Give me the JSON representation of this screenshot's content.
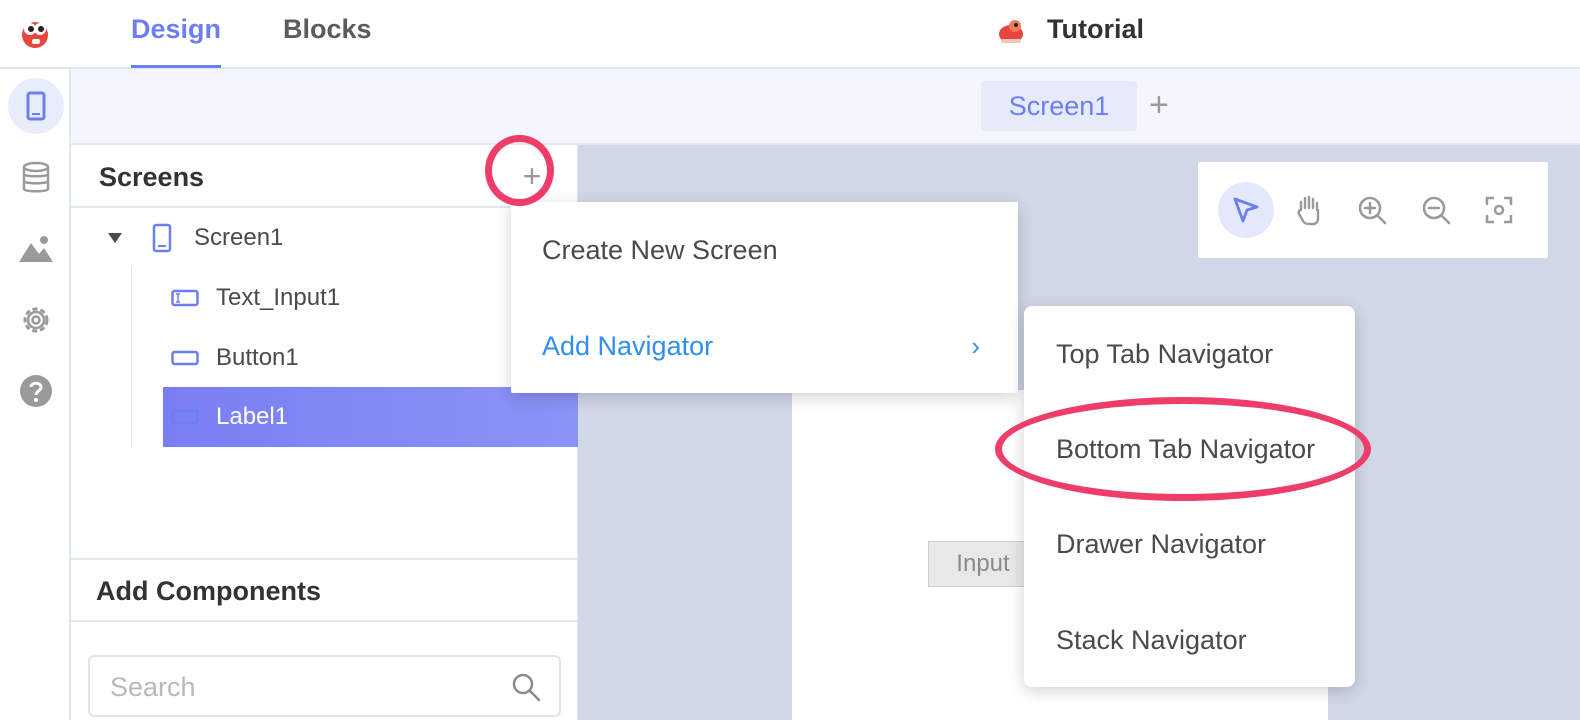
{
  "app": {
    "logo_icon": "app-logo-icon",
    "tabs": [
      {
        "label": "Design",
        "active": true
      },
      {
        "label": "Blocks",
        "active": false
      }
    ],
    "project_name": "Tutorial",
    "accent_color": "#6c7ff2",
    "highlight_color": "#ef3d6a"
  },
  "rail": {
    "items": [
      {
        "icon": "phone-icon",
        "active": true
      },
      {
        "icon": "database-icon",
        "active": false
      },
      {
        "icon": "image-icon",
        "active": false
      },
      {
        "icon": "gear-icon",
        "active": false
      },
      {
        "icon": "help-icon",
        "active": false
      }
    ]
  },
  "screen_tabs": {
    "tabs": [
      "Screen1"
    ],
    "add_label": "+"
  },
  "screens_panel": {
    "title": "Screens",
    "add_label": "+",
    "tree": [
      {
        "label": "Screen1",
        "icon": "phone-icon",
        "expanded": true
      },
      {
        "label": "Text_Input1",
        "icon": "text-input-icon"
      },
      {
        "label": "Button1",
        "icon": "button-icon"
      },
      {
        "label": "Label1",
        "icon": "label-icon",
        "selected": true
      }
    ]
  },
  "components_panel": {
    "title": "Add Components",
    "search_placeholder": "Search",
    "search_value": ""
  },
  "canvas": {
    "input_widget_label": "Input",
    "tools": [
      "pointer-icon",
      "hand-icon",
      "zoom-in-icon",
      "zoom-out-icon",
      "fit-screen-icon"
    ]
  },
  "dropdown_menu": {
    "items": [
      {
        "label": "Create New Screen"
      },
      {
        "label": "Add Navigator",
        "has_submenu": true,
        "chevron": "›"
      }
    ]
  },
  "navigator_submenu": {
    "items": [
      {
        "label": "Top Tab Navigator"
      },
      {
        "label": "Bottom Tab Navigator",
        "highlighted": true
      },
      {
        "label": "Drawer Navigator"
      },
      {
        "label": "Stack Navigator"
      }
    ]
  }
}
